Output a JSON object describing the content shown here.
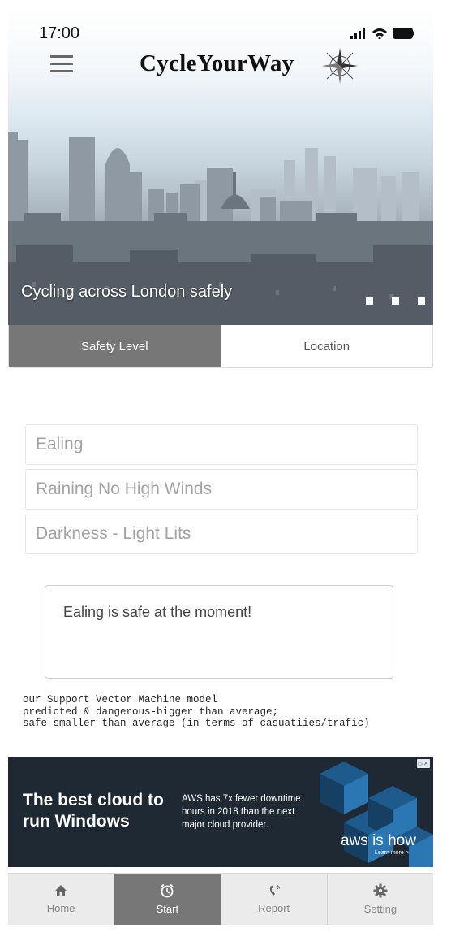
{
  "status_bar": {
    "time": "17:00"
  },
  "header": {
    "brand": "CycleYourWay"
  },
  "hero": {
    "caption": "Cycling across London safely",
    "slide_count": 3
  },
  "tabs": [
    {
      "label": "Safety Level",
      "active": true
    },
    {
      "label": "Location",
      "active": false
    }
  ],
  "info_items": [
    {
      "text": "Ealing"
    },
    {
      "text": "Raining No High Winds"
    },
    {
      "text": "Darkness - Light Lits"
    }
  ],
  "result": {
    "text": "Ealing is safe at the moment!"
  },
  "model_note": {
    "line1": "our Support Vector Machine model",
    "line2": "predicted & dangerous-bigger than average;",
    "line3": "safe-smaller than average (in terms of casuatiies/trafic)"
  },
  "ad": {
    "headline": "The best cloud to run Windows",
    "body": "AWS has 7x fewer downtime hours in 2018 than the next major cloud provider.",
    "logo_text": "aws is how",
    "learn_more": "Learn more >",
    "choice_icon": "ad-choices-icon"
  },
  "bottom_nav": [
    {
      "label": "Home",
      "icon": "home-icon",
      "active": false
    },
    {
      "label": "Start",
      "icon": "clock-icon",
      "active": true
    },
    {
      "label": "Report",
      "icon": "phone-icon",
      "active": false
    },
    {
      "label": "Setting",
      "icon": "gear-icon",
      "active": false
    }
  ],
  "colors": {
    "active_tab": "#777777",
    "ad_background": "#1f2933",
    "nav_background": "#ebebeb"
  }
}
